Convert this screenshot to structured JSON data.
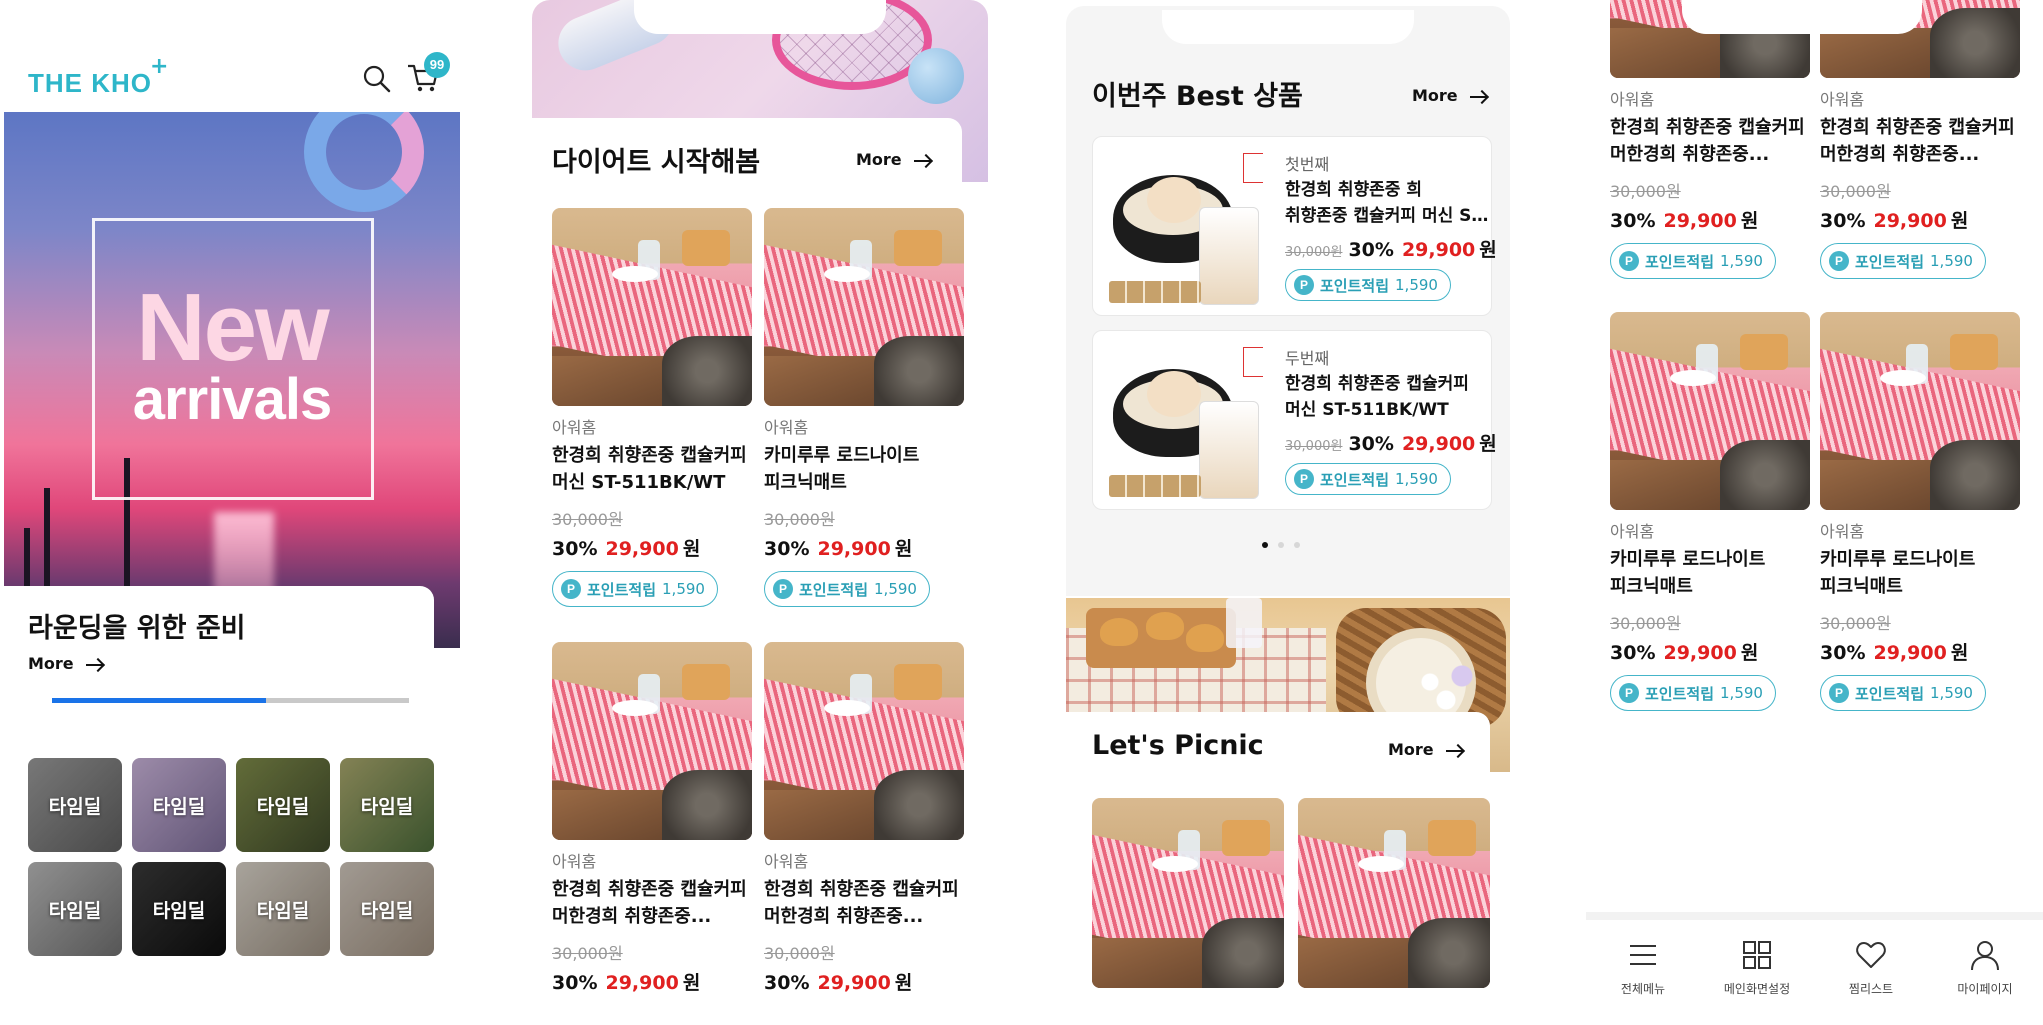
{
  "header": {
    "logo": "THE KHO",
    "logo_plus": "+",
    "cart_badge": "99"
  },
  "hero": {
    "banner_line1": "New",
    "banner_line2": "arrivals",
    "title": "라운딩을 위한 준비",
    "more": "More",
    "progress": 0.6
  },
  "time_deals": [
    "타임딜",
    "타임딜",
    "타임딜",
    "타임딜",
    "타임딜",
    "타임딜",
    "타임딜",
    "타임딜"
  ],
  "diet_section": {
    "title": "다이어트 시작해봄",
    "more": "More",
    "products": [
      {
        "brand": "아워홈",
        "name1": "한경희 취향존중 캡슐커피",
        "name2": "머신 ST-511BK/WT",
        "orig": "30,000원",
        "discount": "30%",
        "price": "29,900",
        "won": "원",
        "point_label": "포인트적립",
        "point_amount": "1,590"
      },
      {
        "brand": "아워홈",
        "name1": "카미루루 로드나이트",
        "name2": "피크닉매트",
        "orig": "30,000원",
        "discount": "30%",
        "price": "29,900",
        "won": "원",
        "point_label": "포인트적립",
        "point_amount": "1,590"
      },
      {
        "brand": "아워홈",
        "name1": "한경희 취향존중 캡슐커피",
        "name2": "머한경희 취향존중...",
        "orig": "30,000원",
        "discount": "30%",
        "price": "29,900",
        "won": "원"
      },
      {
        "brand": "아워홈",
        "name1": "한경희 취향존중 캡슐커피",
        "name2": "머한경희 취향존중...",
        "orig": "30,000원",
        "discount": "30%",
        "price": "29,900",
        "won": "원"
      }
    ]
  },
  "best_section": {
    "title": "이번주 Best 상품",
    "more": "More",
    "items": [
      {
        "rank": "첫번째",
        "name1": "한경희 취향존중 희",
        "name2": "취향존중 캡슐커피 머신 S...",
        "orig": "30,000원",
        "discount": "30%",
        "price": "29,900",
        "won": "원",
        "point_label": "포인트적립",
        "point_amount": "1,590"
      },
      {
        "rank": "두번째",
        "name1": "한경희 취향존중 캡슐커피",
        "name2": "머신 ST-511BK/WT",
        "orig": "30,000원",
        "discount": "30%",
        "price": "29,900",
        "won": "원",
        "point_label": "포인트적립",
        "point_amount": "1,590"
      }
    ]
  },
  "picnic_section": {
    "title": "Let's Picnic",
    "more": "More"
  },
  "col4_products": [
    {
      "brand": "아워홈",
      "name1": "한경희 취향존중 캡슐커피",
      "name2": "머한경희 취향존중...",
      "orig": "30,000원",
      "discount": "30%",
      "price": "29,900",
      "won": "원",
      "point_label": "포인트적립",
      "point_amount": "1,590"
    },
    {
      "brand": "아워홈",
      "name1": "한경희 취향존중 캡슐커피",
      "name2": "머한경희 취향존중...",
      "orig": "30,000원",
      "discount": "30%",
      "price": "29,900",
      "won": "원",
      "point_label": "포인트적립",
      "point_amount": "1,590"
    },
    {
      "brand": "아워홈",
      "name1": "카미루루 로드나이트",
      "name2": "피크닉매트",
      "orig": "30,000원",
      "discount": "30%",
      "price": "29,900",
      "won": "원",
      "point_label": "포인트적립",
      "point_amount": "1,590"
    },
    {
      "brand": "아워홈",
      "name1": "카미루루 로드나이트",
      "name2": "피크닉매트",
      "orig": "30,000원",
      "discount": "30%",
      "price": "29,900",
      "won": "원",
      "point_label": "포인트적립",
      "point_amount": "1,590"
    }
  ],
  "bottom_nav": [
    {
      "label": "전체메뉴",
      "icon": "menu-icon"
    },
    {
      "label": "메인화면설정",
      "icon": "grid-icon"
    },
    {
      "label": "찜리스트",
      "icon": "heart-icon"
    },
    {
      "label": "마이페이지",
      "icon": "user-icon"
    }
  ],
  "colors": {
    "accent": "#2eb6c9",
    "price_red": "#e02020",
    "progress_blue": "#1a73e8"
  }
}
